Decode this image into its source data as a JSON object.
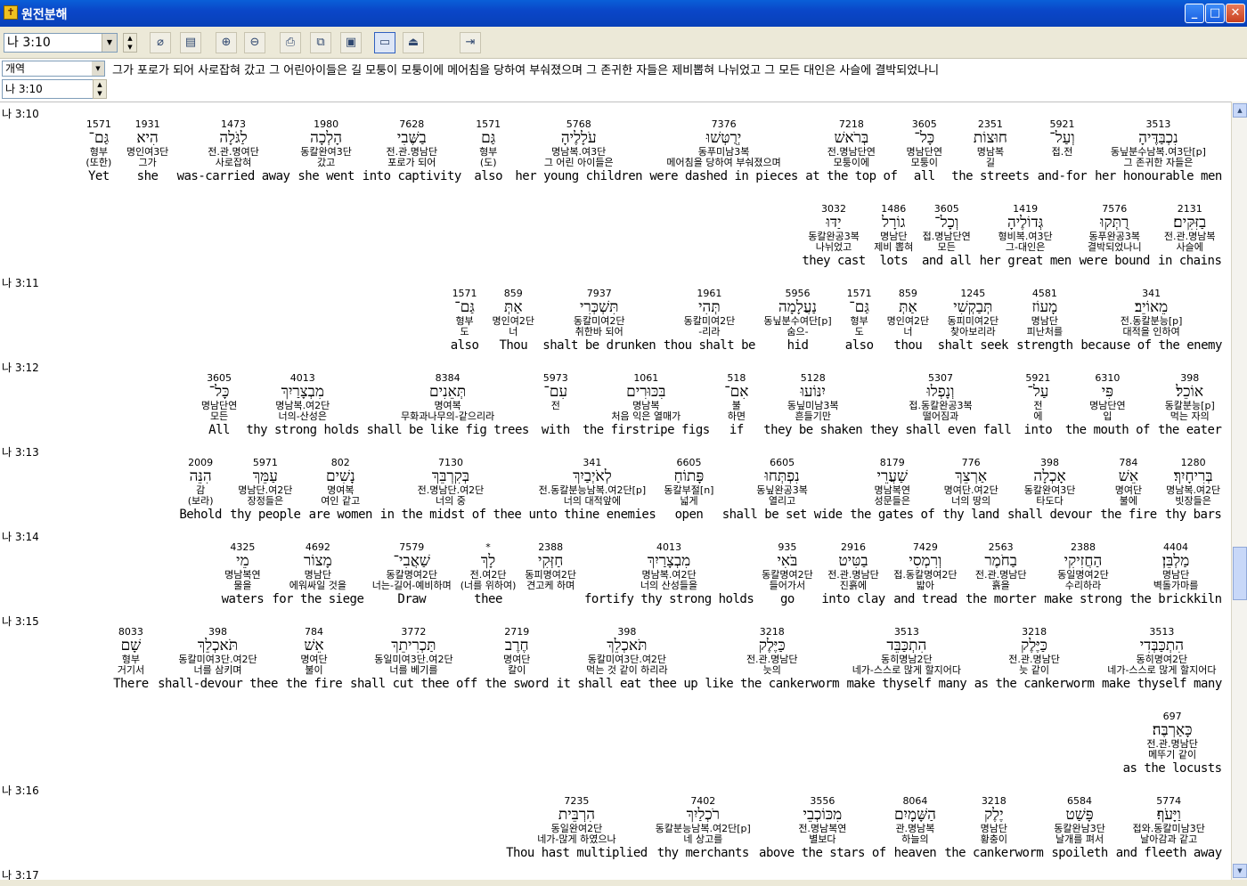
{
  "window": {
    "title": "원전분해"
  },
  "toolbar": {
    "reference": "나 3:10"
  },
  "version": {
    "name": "개역",
    "text": "그가 포로가 되어 사로잡혀 갔고 그 어린아이들은 길 모퉁이 모퉁이에 메어침을 당하여 부숴졌으며 그 존귀한 자들은 제비뽑혀 나뉘었고 그 모든 대인은 사슬에 결박되었나니"
  },
  "reference2": "나 3:10",
  "verses": [
    {
      "label": "나 3:10",
      "lines": [
        [
          {
            "num": "3513",
            "heb": "נִכְבַּדֶּיהָ",
            "gram": "동닢분수남복.여3단[p]",
            "kor": "그 존귀한 자들은",
            "eng": "her honourable men"
          },
          {
            "num": "5921",
            "heb": "וְעַל־",
            "gram": "접.전",
            "kor": "",
            "eng": "and-for"
          },
          {
            "num": "2351",
            "heb": "חוּצוֹת",
            "gram": "명남복",
            "kor": "길",
            "eng": "the streets"
          },
          {
            "num": "3605",
            "heb": "כָּל־",
            "gram": "명남단연",
            "kor": "모퉁이",
            "eng": "all"
          },
          {
            "num": "7218",
            "heb": "בְּרֹאשׁ",
            "gram": "전.명남단연",
            "kor": "모퉁이에",
            "eng": "at the top of"
          },
          {
            "num": "7376",
            "heb": "יְרֻטְּשׁוּ",
            "gram": "동푸미남3복",
            "kor": "메어침을 당하여 부숴졌으며",
            "eng": "were dashed in pieces"
          },
          {
            "num": "5768",
            "heb": "עֹלָלֶיהָ",
            "gram": "명남복.여3단",
            "kor": "그 어린 아이들은",
            "eng": "her young children"
          },
          {
            "num": "1571",
            "heb": "גַּם",
            "gram": "형부",
            "kor": "(도)",
            "eng": "also"
          },
          {
            "num": "7628",
            "heb": "בַשֶּׁבִי",
            "gram": "전.관.명남단",
            "kor": "포로가 되어",
            "eng": "into captivity"
          },
          {
            "num": "1980",
            "heb": "הָלְכָה",
            "gram": "동칼완여3단",
            "kor": "갔고",
            "eng": "she went"
          },
          {
            "num": "1473",
            "heb": "לַגֹּלָה",
            "gram": "전.관.명여단",
            "kor": "사로잡혀",
            "eng": "was-carried away"
          },
          {
            "num": "1931",
            "heb": "הִיא",
            "gram": "명인여3단",
            "kor": "그가",
            "eng": "she"
          },
          {
            "num": "1571",
            "heb": "גַּם־",
            "gram": "형부",
            "kor": "(또한)",
            "eng": "Yet"
          }
        ],
        [
          {
            "num": "2131",
            "heb": "בַזִּקִּים׃",
            "gram": "전.관.명남복",
            "kor": "사슬에",
            "eng": "in chains"
          },
          {
            "num": "7576",
            "heb": "רֻתְּקוּ",
            "gram": "동푸완공3복",
            "kor": "결박되었나니",
            "eng": "were bound"
          },
          {
            "num": "1419",
            "heb": "גְּדוֹלֶיהָ",
            "gram": "형비복.여3단",
            "kor": "그-대인은",
            "eng": "her great men"
          },
          {
            "num": "3605",
            "heb": "וְכָל־",
            "gram": "접.명남단연",
            "kor": "모든",
            "eng": "and all"
          },
          {
            "num": "1486",
            "heb": "גוֹרָל",
            "gram": "명남단",
            "kor": "제비 뽑혀",
            "eng": "lots"
          },
          {
            "num": "3032",
            "heb": "יַדּוּ",
            "gram": "동칼완공3복",
            "kor": "나뉘었고",
            "eng": "they cast"
          }
        ]
      ]
    },
    {
      "label": "나 3:11",
      "lines": [
        [
          {
            "num": "341",
            "heb": "מֵאוֹיֵב׃",
            "gram": "전.동칼분능[p]",
            "kor": "대적을 인하여",
            "eng": "because of the enemy"
          },
          {
            "num": "4581",
            "heb": "מָעוֹז",
            "gram": "명남단",
            "kor": "피난처를",
            "eng": "strength"
          },
          {
            "num": "1245",
            "heb": "תְּבַקְשִׁי",
            "gram": "동피미여2단",
            "kor": "찾아보리라",
            "eng": "shalt seek"
          },
          {
            "num": "859",
            "heb": "אַתְּ",
            "gram": "명인여2단",
            "kor": "너",
            "eng": "thou"
          },
          {
            "num": "1571",
            "heb": "גַּם־",
            "gram": "형부",
            "kor": "도",
            "eng": "also"
          },
          {
            "num": "5956",
            "heb": "נַעֲלָמָה",
            "gram": "동닢분수여단[p]",
            "kor": "숨으-",
            "eng": "hid"
          },
          {
            "num": "1961",
            "heb": "תְּהִי",
            "gram": "동칼미여2단",
            "kor": "-리라",
            "eng": "thou shalt be"
          },
          {
            "num": "7937",
            "heb": "תִּשְׁכְּרִי",
            "gram": "동칼미여2단",
            "kor": "취한바 되어",
            "eng": "shalt be drunken"
          },
          {
            "num": "859",
            "heb": "אַתְּ",
            "gram": "명인여2단",
            "kor": "너",
            "eng": "Thou"
          },
          {
            "num": "1571",
            "heb": "גַּם־",
            "gram": "형부",
            "kor": "도",
            "eng": "also"
          }
        ]
      ]
    },
    {
      "label": "나 3:12",
      "lines": [
        [
          {
            "num": "398",
            "heb": "אוֹכֵל׃",
            "gram": "동칼분능[p]",
            "kor": "먹는 자의",
            "eng": "the eater"
          },
          {
            "num": "6310",
            "heb": "פִּי",
            "gram": "명남단연",
            "kor": "입",
            "eng": "the mouth of"
          },
          {
            "num": "5921",
            "heb": "עַל־",
            "gram": "전",
            "kor": "에",
            "eng": "into"
          },
          {
            "num": "5307",
            "heb": "וְנָפְלוּ",
            "gram": "접.동칼완공3복",
            "kor": "떨어짐과",
            "eng": "they shall even fall"
          },
          {
            "num": "5128",
            "heb": "יִנּוֹעוּ",
            "gram": "동닢미남3복",
            "kor": "흔들기만",
            "eng": "they be shaken"
          },
          {
            "num": "518",
            "heb": "אִם־",
            "gram": "불",
            "kor": "하면",
            "eng": "if"
          },
          {
            "num": "1061",
            "heb": "בִּכּוּרִים",
            "gram": "명남복",
            "kor": "처음 익은 열매가",
            "eng": "the firstripe figs"
          },
          {
            "num": "5973",
            "heb": "עִם־",
            "gram": "전",
            "kor": "",
            "eng": "with"
          },
          {
            "num": "8384",
            "heb": "תְּאֵנִים",
            "gram": "명여복",
            "kor": "무화과나무의-같으리라",
            "eng": "shall be like fig trees"
          },
          {
            "num": "4013",
            "heb": "מִבְצָרַיִךְ",
            "gram": "명남복.여2단",
            "kor": "너의-산성은",
            "eng": "thy strong holds"
          },
          {
            "num": "3605",
            "heb": "כָּל־",
            "gram": "명남단연",
            "kor": "모든",
            "eng": "All"
          }
        ]
      ]
    },
    {
      "label": "나 3:13",
      "lines": [
        [
          {
            "num": "1280",
            "heb": "בְּרִיחָיִךְ׃",
            "gram": "명남복.여2단",
            "kor": "빗장들은",
            "eng": "thy bars"
          },
          {
            "num": "784",
            "heb": "אֵשׁ",
            "gram": "명여단",
            "kor": "불에",
            "eng": "the fire"
          },
          {
            "num": "398",
            "heb": "אָכְלָה",
            "gram": "동칼완여3단",
            "kor": "타도다",
            "eng": "shall devour"
          },
          {
            "num": "776",
            "heb": "אַרְצֵךְ",
            "gram": "명여단.여2단",
            "kor": "너의 땅의",
            "eng": "thy land"
          },
          {
            "num": "8179",
            "heb": "שַׁעֲרֵי",
            "gram": "명남복연",
            "kor": "성문들은",
            "eng": "the gates of"
          },
          {
            "num": "6605",
            "heb": "נִפְתְּחוּ",
            "gram": "동닢완공3복",
            "kor": "열리고",
            "eng": "shall be set wide"
          },
          {
            "num": "6605",
            "heb": "פָּתוֹחַ",
            "gram": "동칼부절[n]",
            "kor": "넓게",
            "eng": "open"
          },
          {
            "num": "341",
            "heb": "לְאֹיְבַיִךְ",
            "gram": "전.동칼분능남복.여2단[p]",
            "kor": "너의 대적앞에",
            "eng": "unto thine enemies"
          },
          {
            "num": "7130",
            "heb": "בְּקִרְבֵּךְ",
            "gram": "전.명남단.여2단",
            "kor": "너의 중",
            "eng": "in the midst of thee"
          },
          {
            "num": "802",
            "heb": "נָשִׁים",
            "gram": "명여복",
            "kor": "여인 같고",
            "eng": "are women"
          },
          {
            "num": "5971",
            "heb": "עַמֵּךְ",
            "gram": "명남단.여2단",
            "kor": "장정들은",
            "eng": "thy people"
          },
          {
            "num": "2009",
            "heb": "הִנֵּה",
            "gram": "감",
            "kor": "(보라)",
            "eng": "Behold"
          }
        ]
      ]
    },
    {
      "label": "나 3:14",
      "lines": [
        [
          {
            "num": "4404",
            "heb": "מַלְבֵּן׃",
            "gram": "명남단",
            "kor": "벽돌가마를",
            "eng": "the brickkiln"
          },
          {
            "num": "2388",
            "heb": "הַחֲזִיקִי",
            "gram": "동일명여2단",
            "kor": "수리하라",
            "eng": "make strong"
          },
          {
            "num": "2563",
            "heb": "בַחֹמֶר",
            "gram": "전.관.명남단",
            "kor": "흙을",
            "eng": "the morter"
          },
          {
            "num": "7429",
            "heb": "וְרִמְסִי",
            "gram": "접.동칼명여2단",
            "kor": "밟아",
            "eng": "and tread"
          },
          {
            "num": "2916",
            "heb": "בַטִּיט",
            "gram": "전.관.명남단",
            "kor": "진흙에",
            "eng": "into clay"
          },
          {
            "num": "935",
            "heb": "בֹּאִי",
            "gram": "동칼명여2단",
            "kor": "들어가서",
            "eng": "go"
          },
          {
            "num": "4013",
            "heb": "מִבְצָרַיִךְ",
            "gram": "명남복.여2단",
            "kor": "너의 산성들을",
            "eng": "fortify thy strong holds"
          },
          {
            "num": "2388",
            "heb": "חַזְּקִי",
            "gram": "동피명여2단",
            "kor": "견고케 하며",
            "eng": ""
          },
          {
            "num": "*",
            "heb": "לָךְ",
            "gram": "전.여2단",
            "kor": "(너를 위하여)",
            "eng": "thee"
          },
          {
            "num": "7579",
            "heb": "שַׁאֲבִי־",
            "gram": "동칼명여2단",
            "kor": "너는-길어-예비하며",
            "eng": "Draw"
          },
          {
            "num": "4692",
            "heb": "מָצוֹר",
            "gram": "명남단",
            "kor": "에워싸일 것을",
            "eng": "for the siege"
          },
          {
            "num": "4325",
            "heb": "מֵי",
            "gram": "명남복연",
            "kor": "물을",
            "eng": "waters"
          }
        ]
      ]
    },
    {
      "label": "나 3:15",
      "lines": [
        [
          {
            "num": "3513",
            "heb": "הִתְכַּבְּדִי",
            "gram": "동히명여2단",
            "kor": "네가-스스로 많게 할지어다",
            "eng": "make thyself many"
          },
          {
            "num": "3218",
            "heb": "כַּיֶּלֶק",
            "gram": "전.관.명남단",
            "kor": "늣 같이",
            "eng": "as the cankerworm"
          },
          {
            "num": "3513",
            "heb": "הִתְכַּבֵּד",
            "gram": "동히명남2단",
            "kor": "네가-스스로 많게 할지어다",
            "eng": "make thyself many"
          },
          {
            "num": "3218",
            "heb": "כַּיֶּלֶק",
            "gram": "전.관.명남단",
            "kor": "늣의",
            "eng": "like the cankerworm"
          },
          {
            "num": "398",
            "heb": "תֹּאכְלֵךְ",
            "gram": "동칼미여3단.여2단",
            "kor": "먹는 것 같이 하리라",
            "eng": "it shall eat thee up"
          },
          {
            "num": "2719",
            "heb": "חֶרֶב",
            "gram": "명여단",
            "kor": "칼이",
            "eng": "the sword"
          },
          {
            "num": "3772",
            "heb": "תַּכְרִיתֵךְ",
            "gram": "동일미여3단.여2단",
            "kor": "너를 베기를",
            "eng": "shall cut thee off"
          },
          {
            "num": "784",
            "heb": "אֵשׁ",
            "gram": "명여단",
            "kor": "불이",
            "eng": "the fire"
          },
          {
            "num": "398",
            "heb": "תֹּאכְלֵךְ",
            "gram": "동칼미여3단.여2단",
            "kor": "너를 삼키며",
            "eng": "shall-devour thee"
          },
          {
            "num": "8033",
            "heb": "שָׁם",
            "gram": "형부",
            "kor": "거기서",
            "eng": "There"
          }
        ],
        [
          {
            "num": "697",
            "heb": "כָּאַרְבֶּה׃",
            "gram": "전.관.명남단",
            "kor": "메뚜기 같이",
            "eng": "as the locusts"
          }
        ]
      ]
    },
    {
      "label": "나 3:16",
      "lines": [
        [
          {
            "num": "5774",
            "heb": "וַיָּעֹף׃",
            "gram": "접와.동칼미남3단",
            "kor": "날아감과 같고",
            "eng": "and fleeth away"
          },
          {
            "num": "6584",
            "heb": "פָּשַׁט",
            "gram": "동칼완남3단",
            "kor": "날개를 펴서",
            "eng": "spoileth"
          },
          {
            "num": "3218",
            "heb": "יֶלֶק",
            "gram": "명남단",
            "kor": "황충이",
            "eng": "the cankerworm"
          },
          {
            "num": "8064",
            "heb": "הַשָּׁמָיִם",
            "gram": "관.명남복",
            "kor": "하늘의",
            "eng": "heaven"
          },
          {
            "num": "3556",
            "heb": "מִכּוֹכְבֵי",
            "gram": "전.명남복연",
            "kor": "별보다",
            "eng": "above the stars of"
          },
          {
            "num": "7402",
            "heb": "רֹכְלַיִךְ",
            "gram": "동칼분능남복.여2단[p]",
            "kor": "네 상고를",
            "eng": "thy merchants"
          },
          {
            "num": "7235",
            "heb": "הִרְבֵּית",
            "gram": "동일완여2단",
            "kor": "네가-많게 하였으나",
            "eng": "Thou hast multiplied"
          }
        ]
      ]
    },
    {
      "label": "나 3:17",
      "lines": []
    }
  ]
}
